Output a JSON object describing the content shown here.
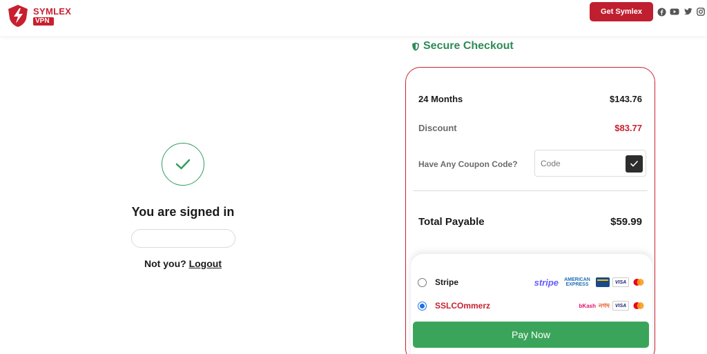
{
  "header": {
    "brand_name": "SYMLEX",
    "brand_sub": "VPN",
    "cta_label": "Get Symlex",
    "social_icons": [
      "facebook-icon",
      "youtube-icon",
      "twitter-icon",
      "instagram-icon"
    ]
  },
  "signin": {
    "title": "You are signed in",
    "email_value": "",
    "not_you": "Not you?",
    "logout_label": "Logout"
  },
  "checkout": {
    "heading": "Secure Checkout",
    "plan_label": "24 Months",
    "plan_price": "$143.76",
    "discount_label": "Discount",
    "discount_value": "$83.77",
    "coupon_label": "Have Any Coupon Code?",
    "coupon_placeholder": "Code",
    "total_label": "Total Payable",
    "total_value": "$59.99",
    "methods": [
      {
        "name": "Stripe",
        "selected": false,
        "brands": [
          "stripe",
          "AMERICAN EXPRESS",
          "card",
          "VISA",
          "mastercard"
        ]
      },
      {
        "name": "SSLCOmmerz",
        "selected": true,
        "brands": [
          "bKash",
          "নগদ",
          "VISA",
          "mastercard"
        ]
      }
    ],
    "pay_label": "Pay Now"
  },
  "colors": {
    "brand_red": "#c8202e",
    "secure_green": "#2e8b57",
    "pay_green": "#3aa55a",
    "radio_blue": "#1a73e8"
  }
}
